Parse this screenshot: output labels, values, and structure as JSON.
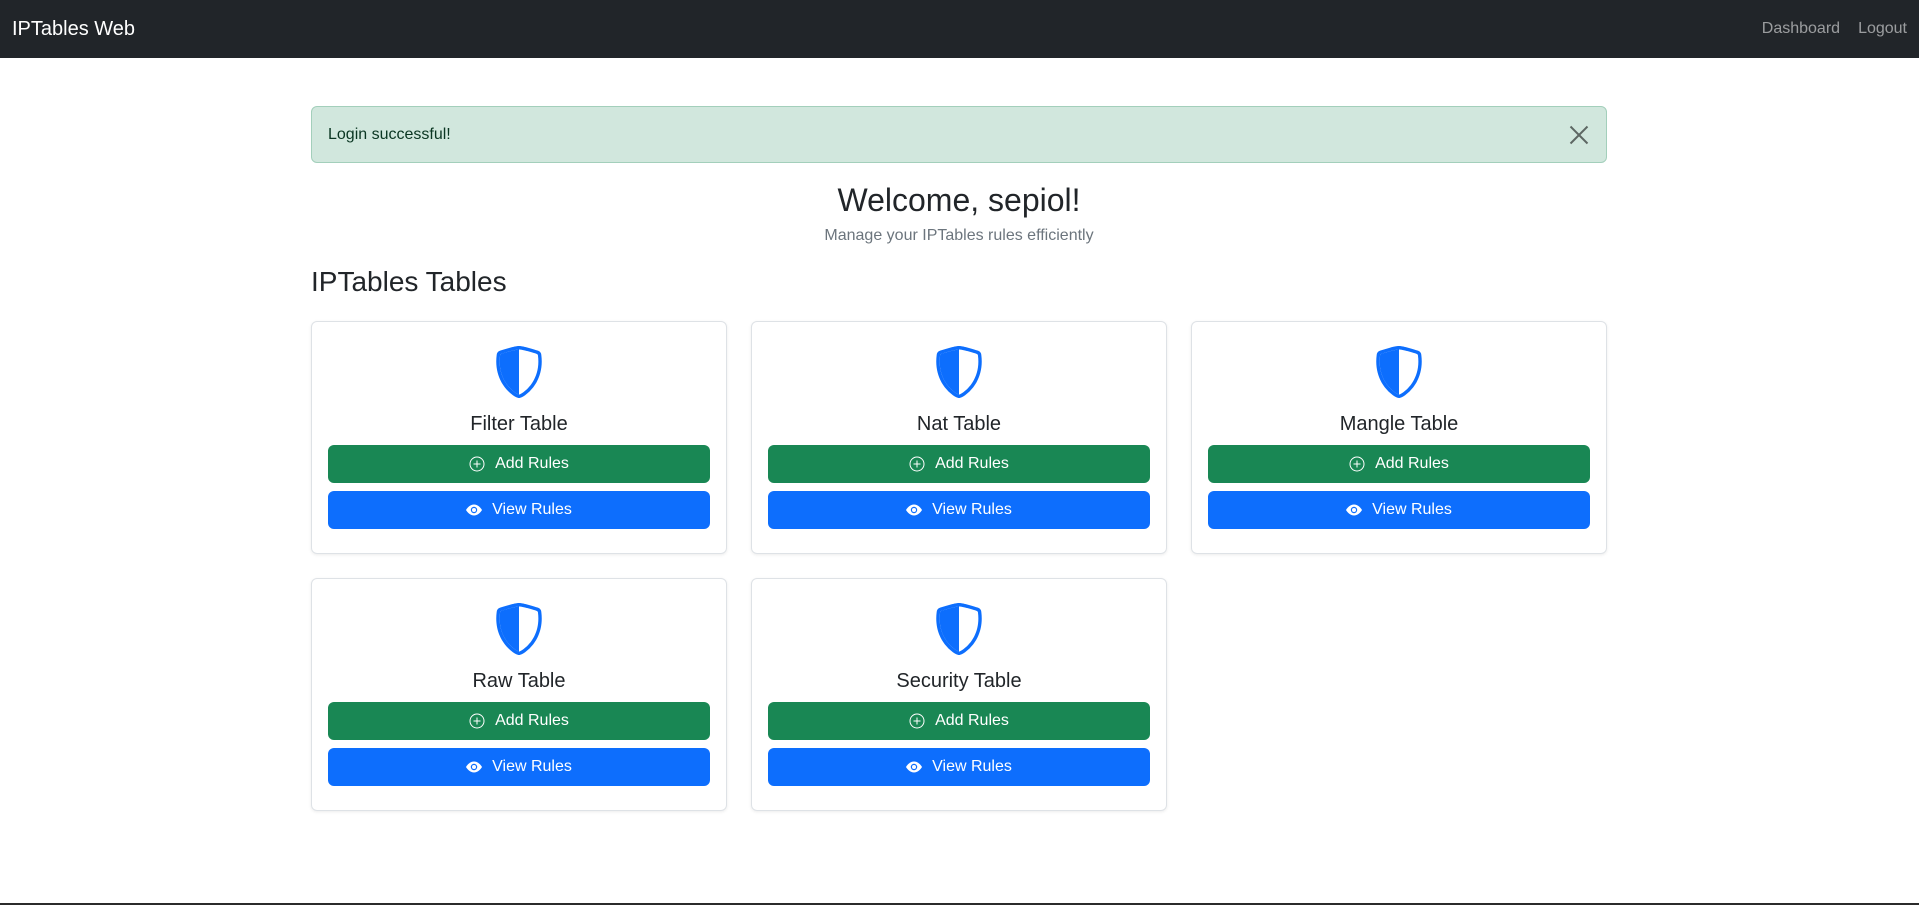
{
  "navbar": {
    "brand": "IPTables Web",
    "links": [
      "Dashboard",
      "Logout"
    ]
  },
  "alert": {
    "message": "Login successful!",
    "close_icon": "close-icon",
    "color": "#d1e7dd"
  },
  "welcome": {
    "title": "Welcome, sepiol!",
    "subtitle": "Manage your IPTables rules efficiently"
  },
  "section_title": "IPTables Tables",
  "cards": [
    {
      "title": "Filter Table",
      "add_label": "Add Rules",
      "view_label": "View Rules"
    },
    {
      "title": "Nat Table",
      "add_label": "Add Rules",
      "view_label": "View Rules"
    },
    {
      "title": "Mangle Table",
      "add_label": "Add Rules",
      "view_label": "View Rules"
    },
    {
      "title": "Raw Table",
      "add_label": "Add Rules",
      "view_label": "View Rules"
    },
    {
      "title": "Security Table",
      "add_label": "Add Rules",
      "view_label": "View Rules"
    }
  ],
  "icons": {
    "card": "shield-half-icon",
    "add": "plus-circle-icon",
    "view": "eye-icon"
  },
  "colors": {
    "navbar": "#212529",
    "add_button": "#198754",
    "view_button": "#0d6efd",
    "shield": "#0d6efd"
  }
}
